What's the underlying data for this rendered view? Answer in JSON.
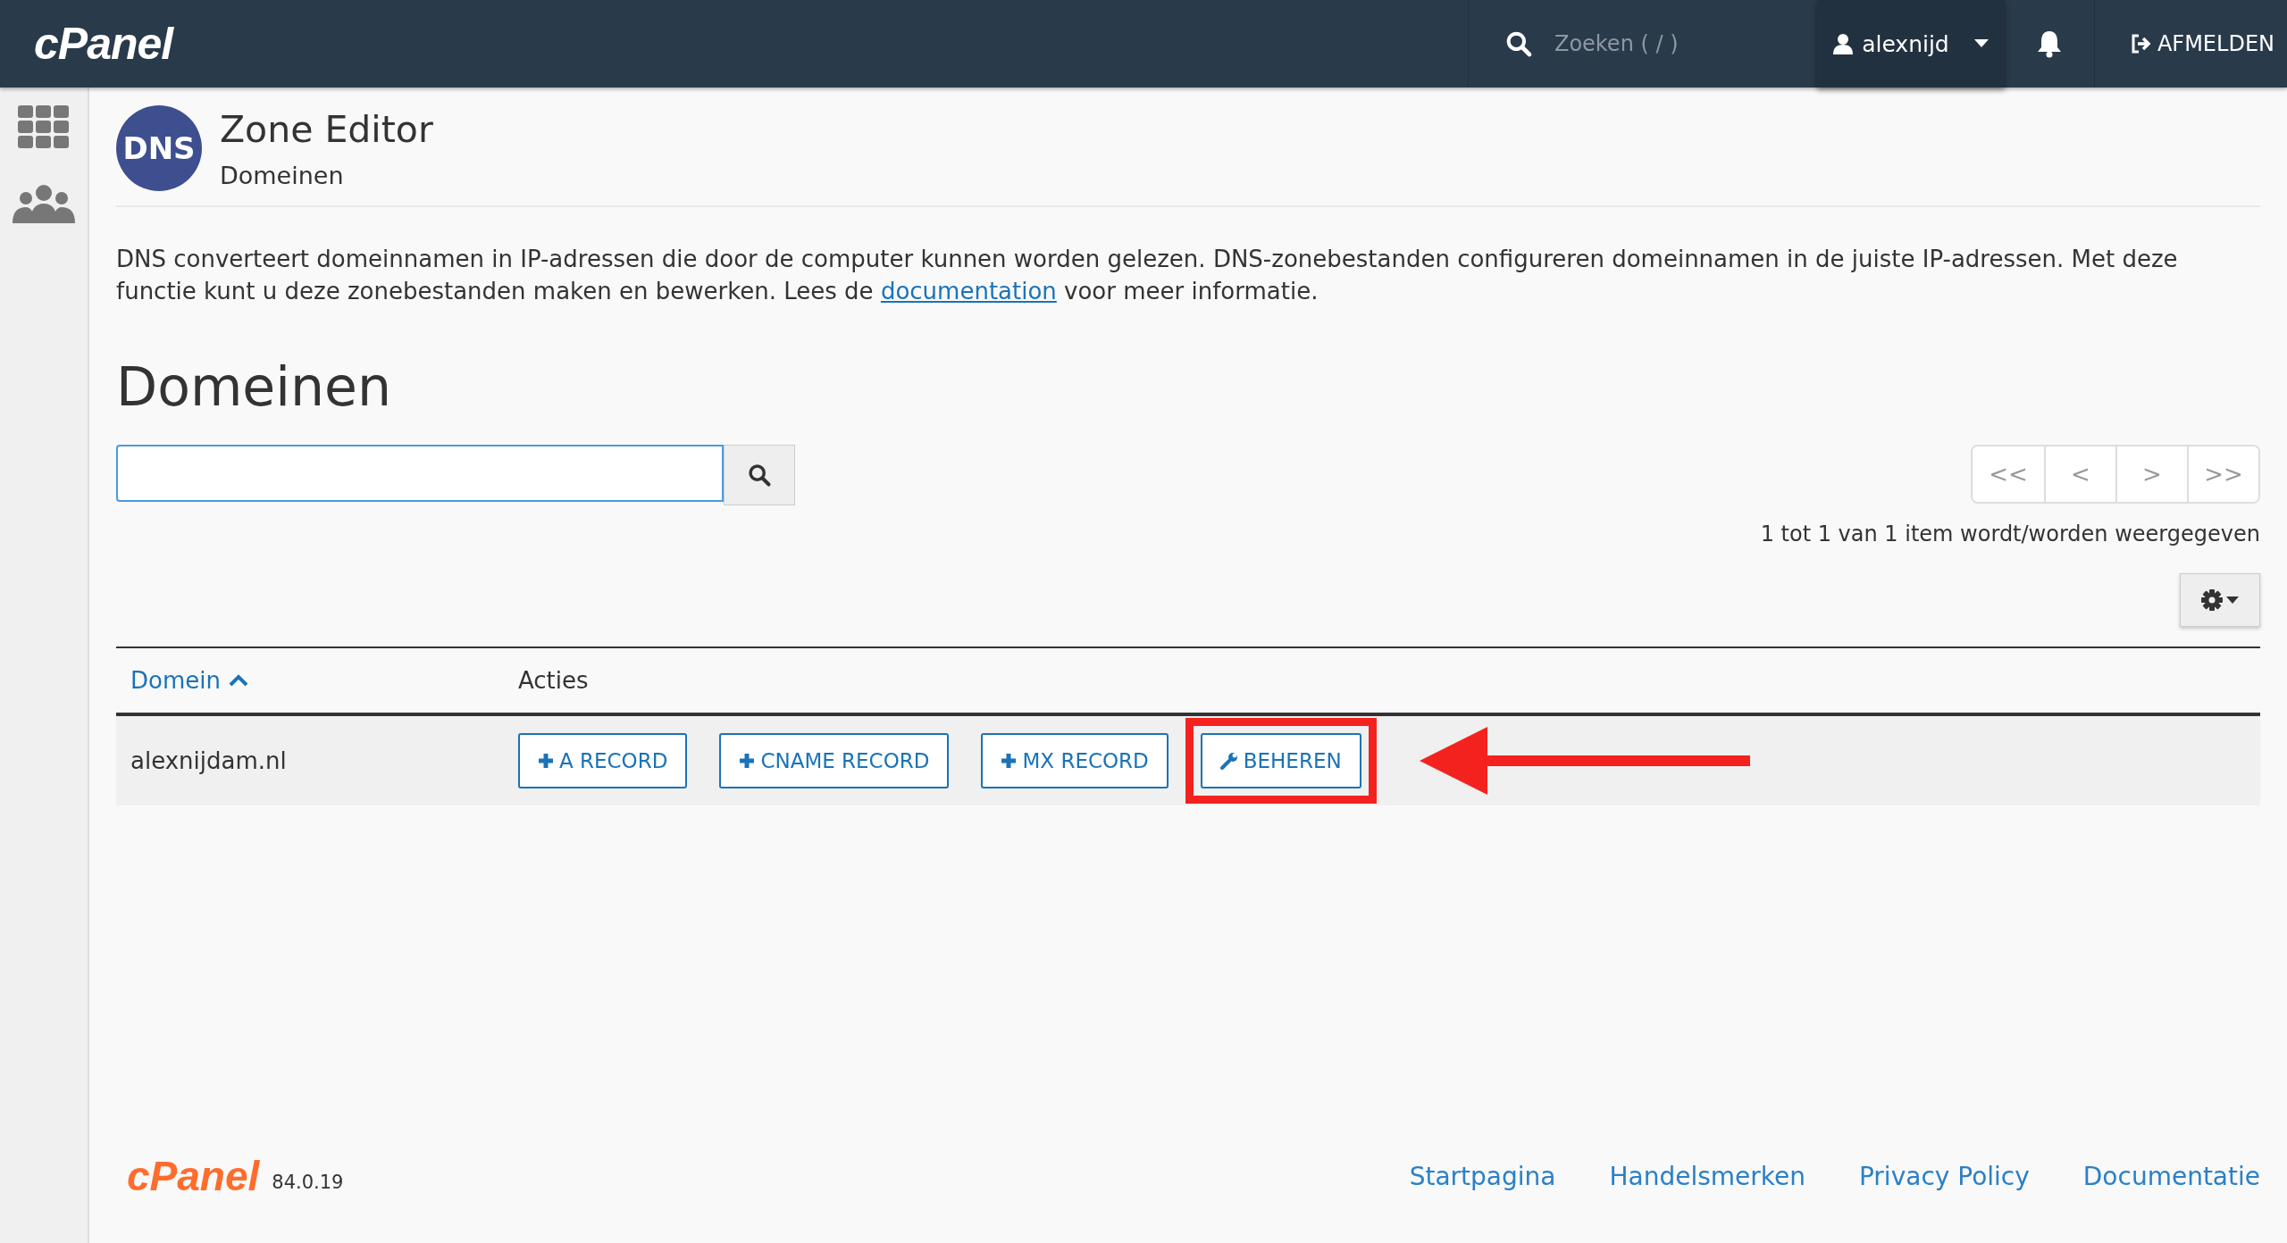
{
  "topbar": {
    "logo": "cPanel",
    "search_placeholder": "Zoeken ( / )",
    "user": "alexnijd",
    "logout": "AFMELDEN"
  },
  "page": {
    "icon_text": "DNS",
    "title": "Zone Editor",
    "subtitle": "Domeinen",
    "description_before": "DNS converteert domeinnamen in IP-adressen die door de computer kunnen worden gelezen. DNS-zonebestanden configureren domeinnamen in de juiste IP-adressen. Met deze functie kunt u deze zonebestanden maken en bewerken. Lees de ",
    "description_link": "documentation",
    "description_after": " voor meer informatie."
  },
  "section_title": "Domeinen",
  "pager": [
    "<<",
    "<",
    ">",
    ">>"
  ],
  "pager_status": "1 tot 1 van 1 item wordt/worden weergegeven",
  "table": {
    "columns": [
      {
        "label": "Domein",
        "sorted": true
      },
      {
        "label": "Acties",
        "sorted": false
      }
    ],
    "rows": [
      {
        "domain": "alexnijdam.nl",
        "actions": [
          {
            "label": "A RECORD",
            "kind": "add",
            "highlighted": false
          },
          {
            "label": "CNAME RECORD",
            "kind": "add",
            "highlighted": false
          },
          {
            "label": "MX RECORD",
            "kind": "add",
            "highlighted": false
          },
          {
            "label": "BEHEREN",
            "kind": "manage",
            "highlighted": true
          }
        ]
      }
    ]
  },
  "footer": {
    "logo": "cPanel",
    "version": "84.0.19",
    "links": [
      "Startpagina",
      "Handelsmerken",
      "Privacy Policy",
      "Documentatie"
    ]
  }
}
